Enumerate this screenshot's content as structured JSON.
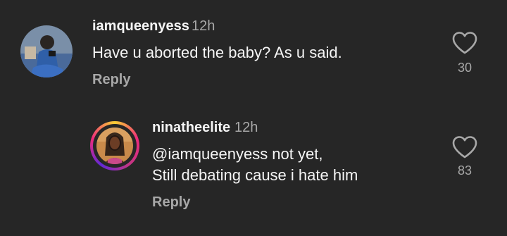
{
  "comments": [
    {
      "username": "iamqueenyess",
      "time": "12h",
      "text": "Have u aborted the baby? As u said.",
      "reply_label": "Reply",
      "like_count": "30"
    },
    {
      "username": "ninatheelite",
      "time": "12h",
      "text": "@iamqueenyess not yet,\nStill debating cause i hate him",
      "reply_label": "Reply",
      "like_count": "83"
    }
  ],
  "icons": {
    "like": "heart-outline-icon",
    "avatar_ring": "story-ring"
  },
  "colors": {
    "background": "#262626",
    "text": "#f5f5f5",
    "secondary": "#a8a8a8"
  }
}
